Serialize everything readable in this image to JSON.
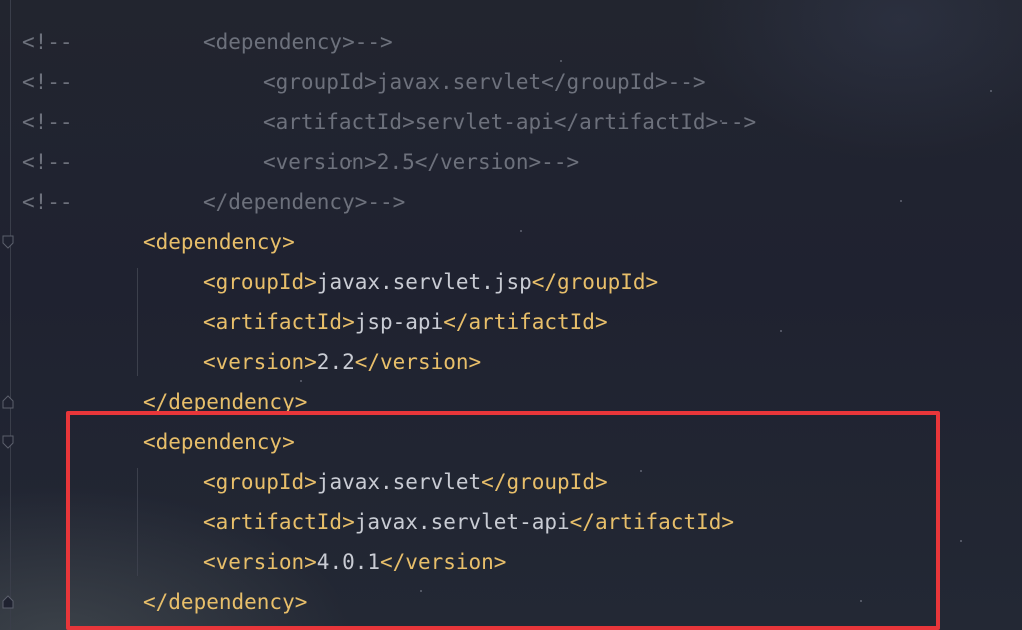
{
  "editor": {
    "lines": [
      {
        "kind": "comment",
        "marker": "<!--",
        "indent": 1,
        "open": "<dependency>",
        "text": "",
        "close": "",
        "tail": "-->"
      },
      {
        "kind": "comment",
        "marker": "<!--",
        "indent": 2,
        "open": "<groupId>",
        "text": "javax.servlet",
        "close": "</groupId>",
        "tail": "-->"
      },
      {
        "kind": "comment",
        "marker": "<!--",
        "indent": 2,
        "open": "<artifactId>",
        "text": "servlet-api",
        "close": "</artifactId>",
        "tail": "-->"
      },
      {
        "kind": "comment",
        "marker": "<!--",
        "indent": 2,
        "open": "<version>",
        "text": "2.5",
        "close": "</version>",
        "tail": "-->"
      },
      {
        "kind": "comment",
        "marker": "<!--",
        "indent": 1,
        "open": "</dependency>",
        "text": "",
        "close": "",
        "tail": "-->"
      },
      {
        "kind": "code",
        "marker": "",
        "indent": 0,
        "open": "<dependency>",
        "text": "",
        "close": "",
        "tail": ""
      },
      {
        "kind": "code",
        "marker": "",
        "indent": 1,
        "open": "<groupId>",
        "text": "javax.servlet.jsp",
        "close": "</groupId>",
        "tail": ""
      },
      {
        "kind": "code",
        "marker": "",
        "indent": 1,
        "open": "<artifactId>",
        "text": "jsp-api",
        "close": "</artifactId>",
        "tail": ""
      },
      {
        "kind": "code",
        "marker": "",
        "indent": 1,
        "open": "<version>",
        "text": "2.2",
        "close": "</version>",
        "tail": ""
      },
      {
        "kind": "code",
        "marker": "",
        "indent": 0,
        "open": "</dependency>",
        "text": "",
        "close": "",
        "tail": ""
      },
      {
        "kind": "code",
        "marker": "",
        "indent": 0,
        "open": "<dependency>",
        "text": "",
        "close": "",
        "tail": ""
      },
      {
        "kind": "code",
        "marker": "",
        "indent": 1,
        "open": "<groupId>",
        "text": "javax.servlet",
        "close": "</groupId>",
        "tail": ""
      },
      {
        "kind": "code",
        "marker": "",
        "indent": 1,
        "open": "<artifactId>",
        "text": "javax.servlet-api",
        "close": "</artifactId>",
        "tail": ""
      },
      {
        "kind": "code",
        "marker": "",
        "indent": 1,
        "open": "<version>",
        "text": "4.0.1",
        "close": "</version>",
        "tail": ""
      },
      {
        "kind": "code",
        "marker": "",
        "indent": 0,
        "open": "</dependency>",
        "text": "",
        "close": "",
        "tail": ""
      }
    ]
  },
  "colors": {
    "tag": "#e8bf6a",
    "text": "#c9ccd4",
    "comment": "#6d717c",
    "highlight": "#e8363a"
  },
  "annotations": {
    "highlight_box": "red-rectangle"
  }
}
